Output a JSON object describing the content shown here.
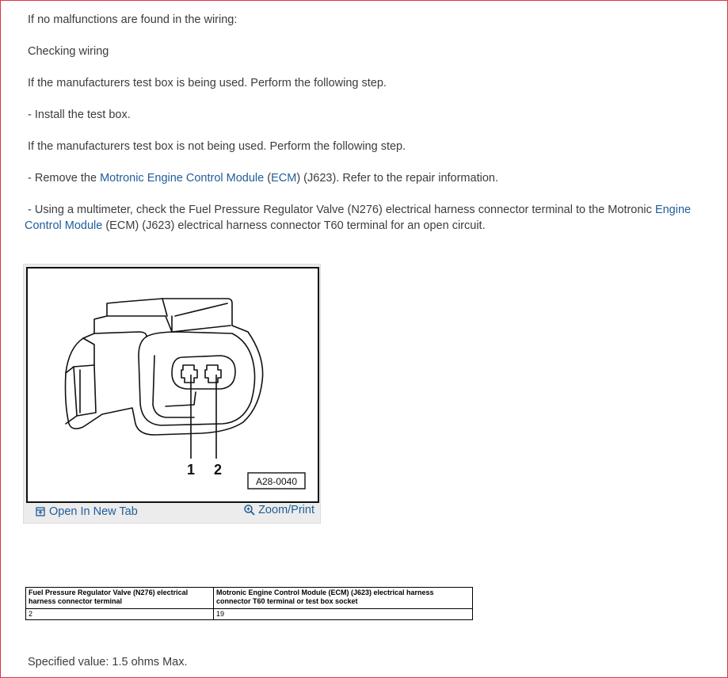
{
  "paragraphs": {
    "p1": "If no malfunctions are found in the wiring:",
    "p2": "Checking wiring",
    "p3": "If the manufacturers test box is being used. Perform the following step.",
    "p4": "-  Install the test box.",
    "p5": "If the manufacturers test box is not being used. Perform the following step.",
    "p6": {
      "prefix": "-  Remove the ",
      "link1": "Motronic Engine Control Module",
      "mid1": " (",
      "link2": "ECM",
      "suffix": ") (J623). Refer to the repair information."
    },
    "p7": {
      "prefix": "-  Using a multimeter, check the Fuel Pressure Regulator Valve (N276) electrical harness connector terminal to the Motronic ",
      "link": "Engine Control Module",
      "suffix": " (ECM) (J623) electrical harness connector T60 terminal for an open circuit."
    }
  },
  "figure": {
    "label1": "1",
    "label2": "2",
    "figure_id": "A28-0040",
    "open_tab_label": "Open In New Tab",
    "zoom_label": "Zoom/Print",
    "link_color": "#1f5d9a"
  },
  "table": {
    "headers": [
      "Fuel Pressure Regulator Valve (N276) electrical harness connector terminal",
      "Motronic Engine Control Module (ECM) (J623) electrical harness connector T60 terminal or test box socket"
    ],
    "rows": [
      [
        "2",
        "19"
      ]
    ]
  },
  "specified_value": "Specified value: 1.5 ohms Max."
}
